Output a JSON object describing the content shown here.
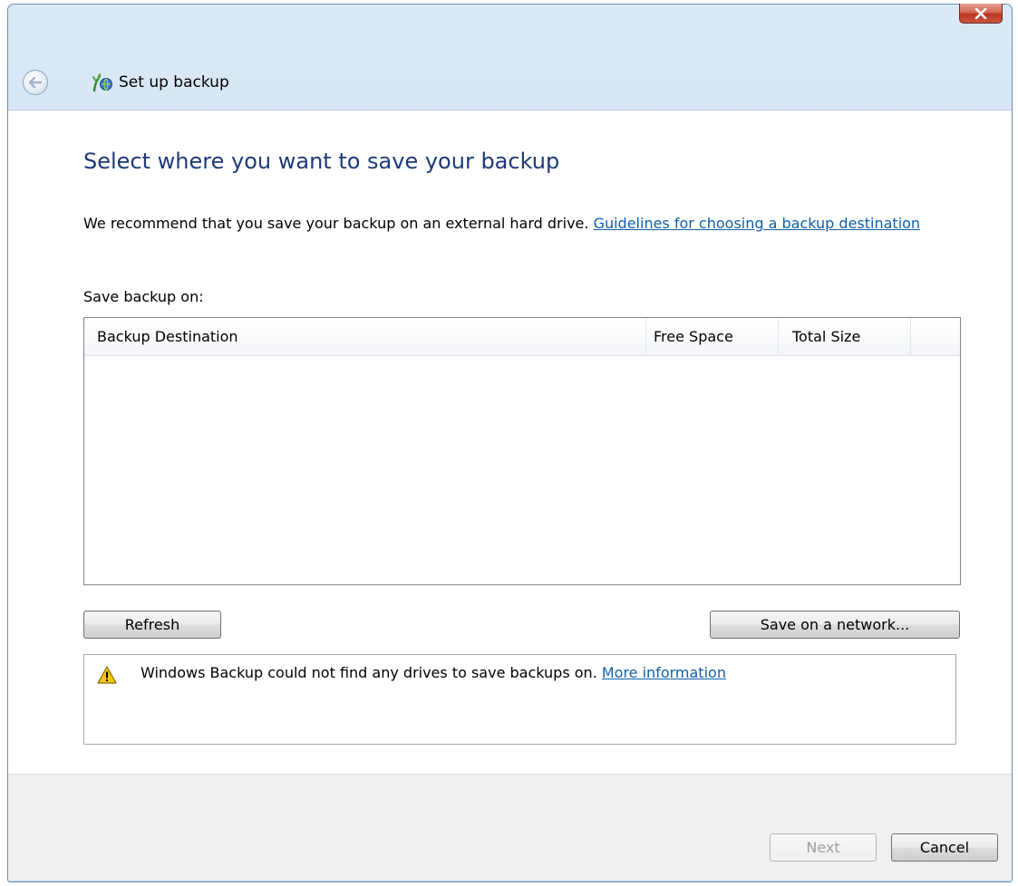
{
  "window": {
    "title": "Set up backup"
  },
  "main": {
    "heading": "Select where you want to save your backup",
    "intro_text": "We recommend that you save your backup on an external hard drive. ",
    "guidelines_link": "Guidelines for choosing a backup destination",
    "save_label": "Save backup on:",
    "table": {
      "columns": [
        "Backup Destination",
        "Free Space",
        "Total Size"
      ],
      "rows": []
    },
    "refresh_button": "Refresh",
    "network_button": "Save on a network...",
    "warning": {
      "icon": "warning-icon",
      "text": "Windows Backup could not find any drives to save backups on. ",
      "link": "More information"
    }
  },
  "footer": {
    "next_button": "Next",
    "next_enabled": false,
    "cancel_button": "Cancel"
  },
  "colors": {
    "heading": "#1e3a78",
    "link": "#0f5fa8",
    "close_button": "#c9563f"
  }
}
